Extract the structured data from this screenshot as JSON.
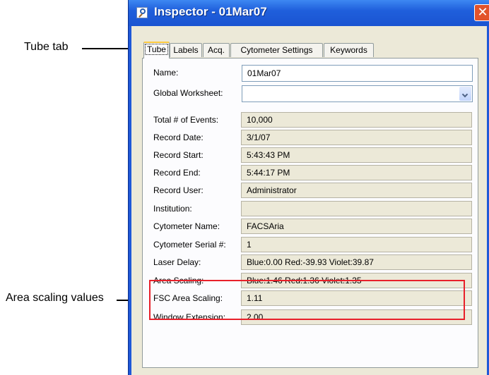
{
  "callouts": {
    "tube_tab": "Tube tab",
    "area_scaling": "Area scaling values"
  },
  "window": {
    "title": "Inspector - 01Mar07",
    "close_symbol": "✕"
  },
  "tabs": [
    {
      "label": "Tube",
      "active": true
    },
    {
      "label": "Labels"
    },
    {
      "label": "Acq."
    },
    {
      "label": "Cytometer Settings"
    },
    {
      "label": "Keywords"
    }
  ],
  "fields": {
    "name": {
      "label": "Name:",
      "value": "01Mar07"
    },
    "global_worksheet": {
      "label": "Global Worksheet:",
      "value": ""
    },
    "total_events": {
      "label": "Total # of Events:",
      "value": "10,000"
    },
    "record_date": {
      "label": "Record Date:",
      "value": "3/1/07"
    },
    "record_start": {
      "label": "Record Start:",
      "value": "5:43:43 PM"
    },
    "record_end": {
      "label": "Record End:",
      "value": "5:44:17 PM"
    },
    "record_user": {
      "label": "Record User:",
      "value": "Administrator"
    },
    "institution": {
      "label": "Institution:",
      "value": ""
    },
    "cytometer_name": {
      "label": "Cytometer Name:",
      "value": "FACSAria"
    },
    "cytometer_serial": {
      "label": "Cytometer Serial #:",
      "value": "1"
    },
    "laser_delay": {
      "label": "Laser Delay:",
      "value": "Blue:0.00  Red:-39.93  Violet:39.87"
    },
    "area_scaling": {
      "label": "Area Scaling:",
      "value": "Blue:1.46  Red:1.36  Violet:1.35"
    },
    "fsc_area_scaling": {
      "label": "FSC Area Scaling:",
      "value": "1.11"
    },
    "window_extension": {
      "label": "Window Extension:",
      "value": "2.00"
    }
  },
  "colors": {
    "highlight": "#e8202a",
    "titlebar": "#1f5fdc",
    "active_tab_accent": "#ffc83c"
  }
}
